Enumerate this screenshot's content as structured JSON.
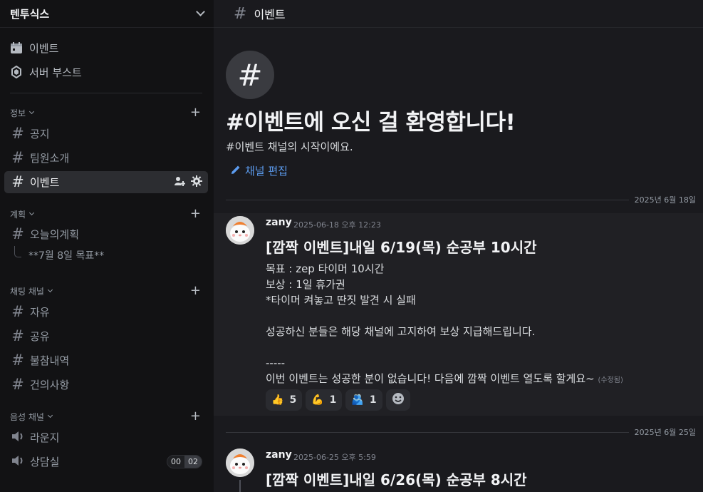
{
  "server": {
    "name": "텐투식스"
  },
  "sidebar": {
    "top_items": [
      {
        "label": "이벤트"
      },
      {
        "label": "서버 부스트"
      }
    ],
    "categories": [
      {
        "label": "정보",
        "channels": [
          "공지",
          "팀원소개",
          "이벤트"
        ]
      },
      {
        "label": "계획",
        "channels": [
          "오늘의계획"
        ],
        "thread": "**7월 8일 목표**"
      },
      {
        "label": "채팅 채널",
        "channels": [
          "자유",
          "공유",
          "불참내역",
          "건의사항"
        ]
      },
      {
        "label": "음성 채널",
        "channels": [
          "라운지",
          "상담실"
        ],
        "counter": [
          "00",
          "02"
        ]
      }
    ]
  },
  "channel": {
    "name": "이벤트",
    "welcome_title": "#이벤트에 오신 걸 환영합니다!",
    "welcome_sub": "#이벤트 채널의 시작이에요.",
    "edit_label": "채널 편집"
  },
  "messages": [
    {
      "date_divider": "2025년 6월 18일",
      "author": "zany",
      "timestamp": "2025-06-18 오후 12:23",
      "title": "[깜짝 이벤트]내일 6/19(목) 순공부 10시간",
      "lines": [
        "목표 : zep 타이머 10시간",
        "보상 : 1일 휴가권",
        "*타이머 켜놓고 딴짓 발견 시 실패",
        "",
        "성공하신 분들은 해당 채널에 고지하여 보상 지급해드립니다.",
        "",
        "-----"
      ],
      "last_line": "이번 이벤트는 성공한 분이 없습니다! 다음에 깜짝 이벤트 열도록 할게요~",
      "edited": "(수정됨)",
      "reactions": [
        {
          "emoji": "👍",
          "count": "5"
        },
        {
          "emoji": "💪",
          "count": "1"
        },
        {
          "emoji": "🫂",
          "count": "1"
        }
      ]
    },
    {
      "date_divider": "2025년 6월 25일",
      "author": "zany",
      "timestamp": "2025-06-25 오후 5:59",
      "title": "[깜짝 이벤트]내일 6/26(목) 순공부 8시간"
    }
  ],
  "colors": {
    "accent_link": "#5c9cf0",
    "sidebar_bg": "#121214",
    "main_bg": "#1a1a1e"
  }
}
